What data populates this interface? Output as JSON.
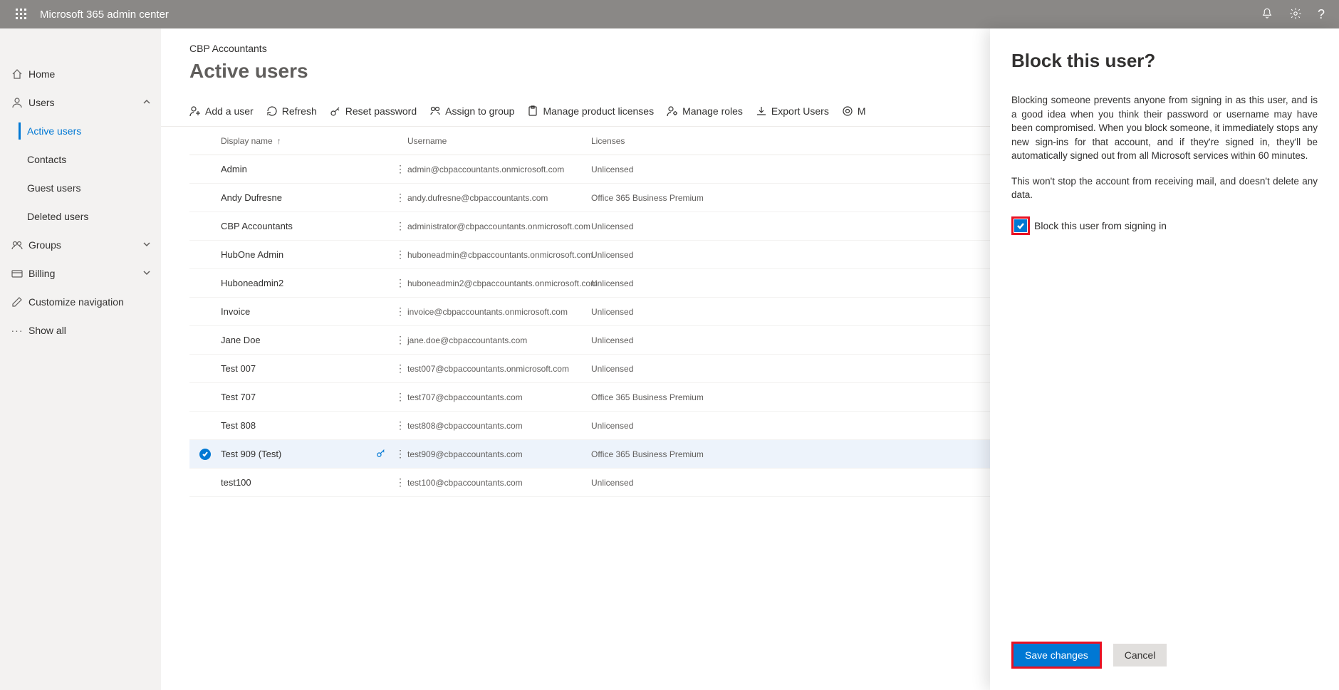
{
  "topbar": {
    "title": "Microsoft 365 admin center"
  },
  "sidebar": {
    "home": "Home",
    "users": "Users",
    "users_sub": [
      "Active users",
      "Contacts",
      "Guest users",
      "Deleted users"
    ],
    "groups": "Groups",
    "billing": "Billing",
    "customize": "Customize navigation",
    "showall": "Show all"
  },
  "crumb": "CBP Accountants",
  "page_title": "Active users",
  "cmds": {
    "add": "Add a user",
    "refresh": "Refresh",
    "reset": "Reset password",
    "assign": "Assign to group",
    "licenses": "Manage product licenses",
    "roles": "Manage roles",
    "export": "Export Users",
    "more": "M"
  },
  "cols": {
    "name": "Display name",
    "user": "Username",
    "lic": "Licenses"
  },
  "rows": [
    {
      "name": "Admin",
      "user": "admin@cbpaccountants.onmicrosoft.com",
      "lic": "Unlicensed",
      "sel": false
    },
    {
      "name": "Andy Dufresne",
      "user": "andy.dufresne@cbpaccountants.com",
      "lic": "Office 365 Business Premium",
      "sel": false
    },
    {
      "name": "CBP Accountants",
      "user": "administrator@cbpaccountants.onmicrosoft.com",
      "lic": "Unlicensed",
      "sel": false
    },
    {
      "name": "HubOne Admin",
      "user": "huboneadmin@cbpaccountants.onmicrosoft.com",
      "lic": "Unlicensed",
      "sel": false
    },
    {
      "name": "Huboneadmin2",
      "user": "huboneadmin2@cbpaccountants.onmicrosoft.com",
      "lic": "Unlicensed",
      "sel": false
    },
    {
      "name": "Invoice",
      "user": "invoice@cbpaccountants.onmicrosoft.com",
      "lic": "Unlicensed",
      "sel": false
    },
    {
      "name": "Jane Doe",
      "user": "jane.doe@cbpaccountants.com",
      "lic": "Unlicensed",
      "sel": false
    },
    {
      "name": "Test 007",
      "user": "test007@cbpaccountants.onmicrosoft.com",
      "lic": "Unlicensed",
      "sel": false
    },
    {
      "name": "Test 707",
      "user": "test707@cbpaccountants.com",
      "lic": "Office 365 Business Premium",
      "sel": false
    },
    {
      "name": "Test 808",
      "user": "test808@cbpaccountants.com",
      "lic": "Unlicensed",
      "sel": false
    },
    {
      "name": "Test 909 (Test)",
      "user": "test909@cbpaccountants.com",
      "lic": "Office 365 Business Premium",
      "sel": true
    },
    {
      "name": "test100",
      "user": "test100@cbpaccountants.com",
      "lic": "Unlicensed",
      "sel": false
    }
  ],
  "panel": {
    "title": "Block this user?",
    "p1": "Blocking someone prevents anyone from signing in as this user, and is a good idea when you think their password or username may have been compromised. When you block someone, it immediately stops any new sign-ins for that account, and if they're signed in, they'll be automatically signed out from all Microsoft services within 60 minutes.",
    "p2": "This won't stop the account from receiving mail, and doesn't delete any data.",
    "cb_label": "Block this user from signing in",
    "save": "Save changes",
    "cancel": "Cancel"
  }
}
